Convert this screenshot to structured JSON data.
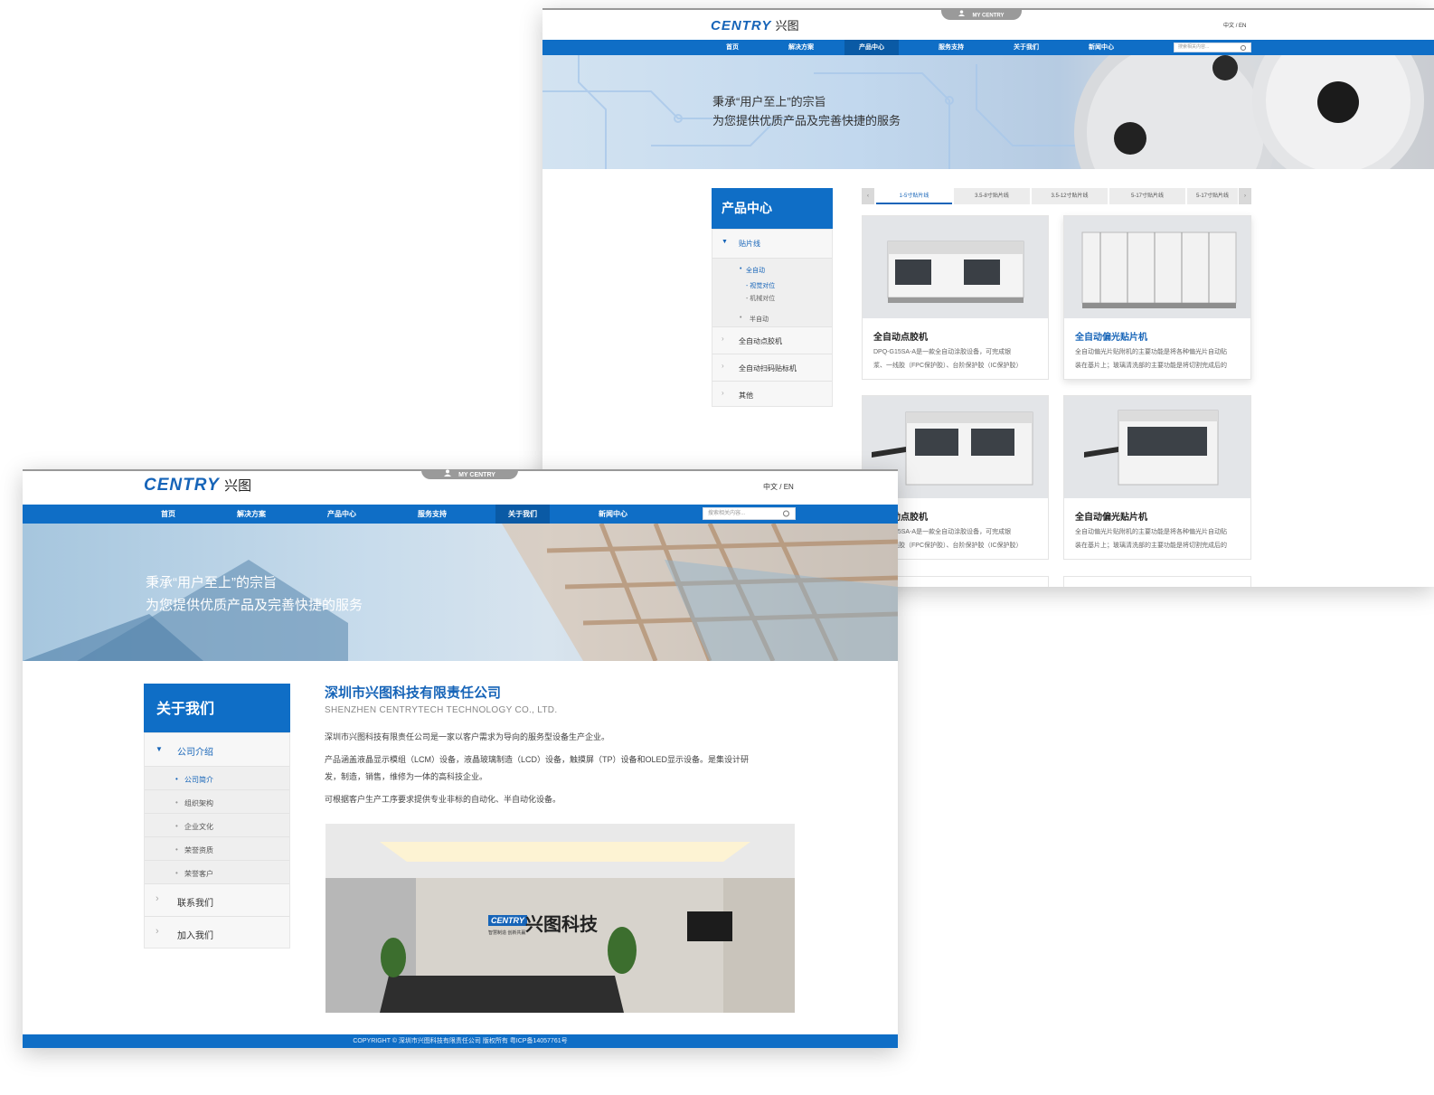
{
  "windowB": {
    "logo_en": "CENTRY",
    "logo_cn": "兴图",
    "my_centry": "MY CENTRY",
    "lang_cn": "中文",
    "lang_sep": "/",
    "lang_en": "EN",
    "nav": [
      "首页",
      "解决方案",
      "产品中心",
      "服务支持",
      "关于我们",
      "新闻中心"
    ],
    "active_nav": "产品中心",
    "search_placeholder": "搜索相关内容...",
    "banner_line1": "秉承“用户至上”的宗旨",
    "banner_line2": "为您提供优质产品及完善快捷的服务",
    "side_title": "产品中心",
    "side_items": {
      "line": "贴片线",
      "full_auto": "全自动",
      "vision": "- 视觉对位",
      "mech": "- 机械对位",
      "semi_auto": "半自动",
      "dispenser": "全自动点胶机",
      "scanner": "全自动扫码贴标机",
      "other": "其他"
    },
    "tabs": [
      "1-5寸贴片线",
      "3.5-8寸贴片线",
      "3.5-12寸贴片线",
      "5-17寸贴片线",
      "5-17寸贴片线"
    ],
    "cards": [
      {
        "title": "全自动点胶机",
        "desc1": "DPQ-G15SA-A是一款全自动涂胶设备，可完成银",
        "desc2": "浆、一线胶（FPC保护胶）、台阶保护胶（IC保护胶）"
      },
      {
        "title": "全自动偏光贴片机",
        "desc1": "全自动偏光片贴附机的主要功能是将各种偏光片自动贴",
        "desc2": "装在基片上；玻璃清洗部的主要功能是将切割完成后的"
      },
      {
        "title": "全自动点胶机",
        "desc1": "DPQ-G15SA-A是一款全自动涂胶设备，可完成银",
        "desc2": "浆、一线胶（FPC保护胶）、台阶保护胶（IC保护胶）"
      },
      {
        "title": "全自动偏光贴片机",
        "desc1": "全自动偏光片贴附机的主要功能是将各种偏光片自动贴",
        "desc2": "装在基片上；玻璃清洗部的主要功能是将切割完成后的"
      }
    ]
  },
  "windowA": {
    "logo_en": "CENTRY",
    "logo_cn": "兴图",
    "my_centry": "MY CENTRY",
    "lang_cn": "中文",
    "lang_sep": "/",
    "lang_en": "EN",
    "nav": [
      "首页",
      "解决方案",
      "产品中心",
      "服务支持",
      "关于我们",
      "新闻中心"
    ],
    "active_nav": "关于我们",
    "search_placeholder": "搜索相关内容...",
    "banner_line1": "秉承“用户至上”的宗旨",
    "banner_line2": "为您提供优质产品及完善快捷的服务",
    "side_title": "关于我们",
    "side_group": "公司介绍",
    "side_sub": [
      "公司简介",
      "组织架构",
      "企业文化",
      "荣誉资质",
      "荣誉客户"
    ],
    "side_more": [
      "联系我们",
      "加入我们"
    ],
    "company_name": "深圳市兴图科技有限责任公司",
    "company_en": "SHENZHEN CENTRYTECH TECHNOLOGY CO., LTD.",
    "para1": "深圳市兴图科技有限责任公司是一家以客户需求为导向的服务型设备生产企业。",
    "para2a": "产品涵盖液晶显示模组（LCM）设备，液晶玻璃制造（LCD）设备，触摸屏（TP）设备和OLED显示设备。是集设计研",
    "para2b": "发，制造，销售，维修为一体的高科技企业。",
    "para3": "可根据客户生产工序要求提供专业非标的自动化、半自动化设备。",
    "wall_logo": "CENTRY",
    "wall_sub": "智慧制造 创新共赢",
    "wall_cn": "兴图科技",
    "footer": "COPYRIGHT © 深圳市兴图科技有限责任公司 版权所有   粤ICP备14057761号"
  },
  "colors": {
    "brand": "#0f6ec6",
    "nav_active": "#0a5aa5",
    "footer": "#0f6ec6"
  }
}
